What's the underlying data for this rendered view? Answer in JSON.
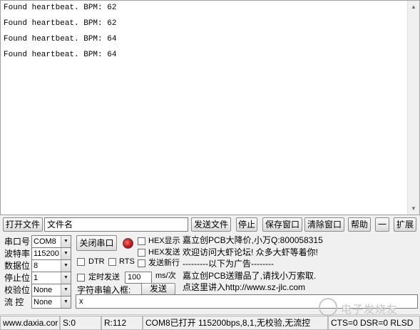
{
  "receive": {
    "lines": [
      "Found heartbeat. BPM: 62",
      "Found heartbeat. BPM: 62",
      "Found heartbeat. BPM: 64",
      "Found heartbeat. BPM: 64"
    ]
  },
  "toolbar": {
    "open_file": "打开文件",
    "file_name": "文件名",
    "send_file": "发送文件",
    "stop": "停止",
    "save_window": "保存窗口",
    "clear_window": "清除窗口",
    "help": "帮助",
    "minus": "一",
    "expand": "扩展"
  },
  "settings": {
    "port_label": "串口号",
    "port_value": "COM8",
    "baud_label": "波特率",
    "baud_value": "115200",
    "databits_label": "数据位",
    "databits_value": "8",
    "stopbits_label": "停止位",
    "stopbits_value": "1",
    "parity_label": "校验位",
    "parity_value": "None",
    "flow_label": "流 控",
    "flow_value": "None"
  },
  "controls": {
    "close_port": "关闭串口",
    "hex_display": "HEX显示",
    "hex_send": "HEX发送",
    "dtr": "DTR",
    "rts": "RTS",
    "send_newline": "发送新行",
    "timed_send": "定时发送",
    "interval_value": "100",
    "interval_unit": "ms/次",
    "string_input_label": "字符串输入框:",
    "send_button": "发送",
    "send_text": "x"
  },
  "ad": {
    "lines": [
      "嘉立创PCB大降价,小万Q:800058315",
      "欢迎访问大虾论坛! 众多大虾等着你!",
      "---------以下为广告--------",
      "嘉立创PCB送赠品了,请找小万索取.",
      "点这里讲入http://www.sz-jlc.com"
    ]
  },
  "status": {
    "site": "www.daxia.cor",
    "sent": "S:0",
    "received": "R:112",
    "port_status": "COM8已打开  115200bps,8,1,无校验,无流控",
    "signals": "CTS=0 DSR=0 RLSD"
  },
  "watermark": {
    "text": "电子发烧友"
  },
  "colors": {
    "led": "#c01818",
    "background": "#f0f0f0"
  }
}
